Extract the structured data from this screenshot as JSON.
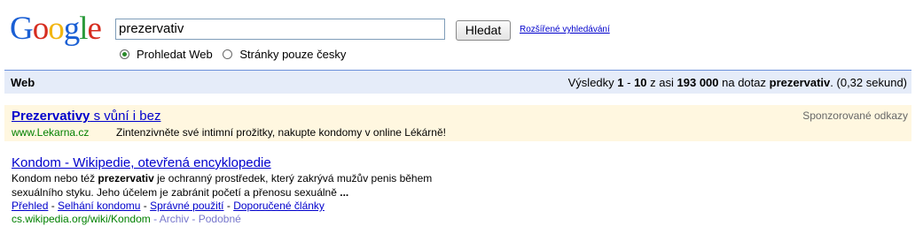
{
  "logo": {
    "letters": [
      "G",
      "o",
      "o",
      "g",
      "l",
      "e"
    ],
    "colors": [
      "#1a5fd4",
      "#d62d20",
      "#f2b50f",
      "#1a5fd4",
      "#2a9a3a",
      "#d62d20"
    ]
  },
  "search": {
    "query": "prezervativ",
    "button": "Hledat",
    "advanced": "Rozšířené vyhledávání"
  },
  "options": {
    "web": "Prohledat Web",
    "czech": "Stránky pouze česky",
    "selected": "web"
  },
  "bar": {
    "tab": "Web",
    "stats_prefix": "Výsledky ",
    "range_start": "1",
    "dash": " - ",
    "range_end": "10",
    "mid": " z asi ",
    "total": "193 000",
    "mid2": " na dotaz ",
    "query": "prezervativ",
    "suffix": ". (0,32 sekund)"
  },
  "ad": {
    "title_bold": "Prezervativy",
    "title_rest": " s vůní i bez",
    "sponsored": "Sponzorované odkazy",
    "url": "www.Lekarna.cz",
    "desc": "Zintenzivněte své intimní prožitky, nakupte kondomy v online Lékárně!"
  },
  "result": {
    "title": "Kondom - Wikipedie, otevřená encyklopedie",
    "snip1": "Kondom nebo též ",
    "snip_bold": "prezervativ",
    "snip2": " je ochranný prostředek, který zakrývá mužův penis během",
    "snip3": "sexuálního styku. Jeho účelem je zabránit početí a přenosu sexuálně ",
    "ellipsis": "...",
    "links": [
      "Přehled",
      "Selhání kondomu",
      "Správné použití",
      "Doporučené články"
    ],
    "sep": " - ",
    "url": "cs.wikipedia.org/wiki/Kondom",
    "archive": " - Archiv",
    "similar": " - Podobné"
  }
}
